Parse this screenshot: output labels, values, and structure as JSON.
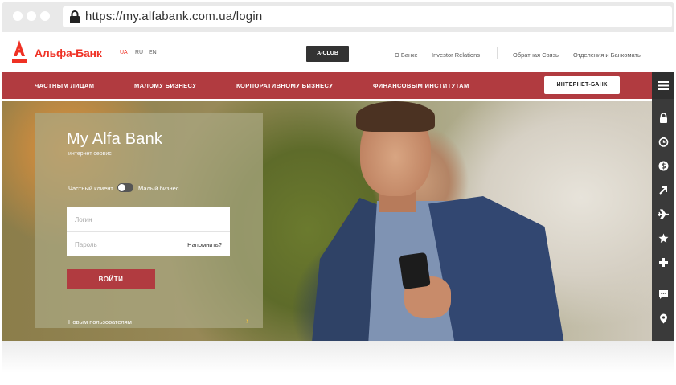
{
  "browser": {
    "url": "https://my.alfabank.com.ua/login"
  },
  "header": {
    "brand": "Альфа-Банк",
    "languages": [
      "UA",
      "RU",
      "EN"
    ],
    "active_language": "UA",
    "aclub_label": "A-CLUB",
    "links": [
      "О Банке",
      "Investor Relations",
      "Обратная Связь",
      "Отделения и Банкоматы"
    ]
  },
  "nav": {
    "items": [
      "ЧАСТНЫМ ЛИЦАМ",
      "МАЛОМУ БИЗНЕСУ",
      "КОРПОРАТИВНОМУ БИЗНЕСУ",
      "ФИНАНСОВЫМ ИНСТИТУТАМ"
    ],
    "internet_bank_label": "ИНТЕРНЕТ-БАНК"
  },
  "login": {
    "title": "My Alfa Bank",
    "subtitle": "интернет сервис",
    "toggle_left": "Частный клиент",
    "toggle_right": "Малый бизнес",
    "login_placeholder": "Логин",
    "password_placeholder": "Пароль",
    "remind_label": "Напомнить?",
    "submit_label": "ВОЙТИ",
    "new_users_label": "Новым пользователям",
    "new_users_arrow": "›"
  },
  "sidebar": {
    "icons": [
      "menu-icon",
      "lock-icon",
      "clock-icon",
      "dollar-icon",
      "arrow-icon",
      "plane-icon",
      "star-icon",
      "plus-icon",
      "chat-icon",
      "map-pin-icon"
    ]
  },
  "colors": {
    "brand_red": "#ef3124",
    "nav_red": "#b13b40",
    "sidebar_dark": "#3a3a3a"
  }
}
